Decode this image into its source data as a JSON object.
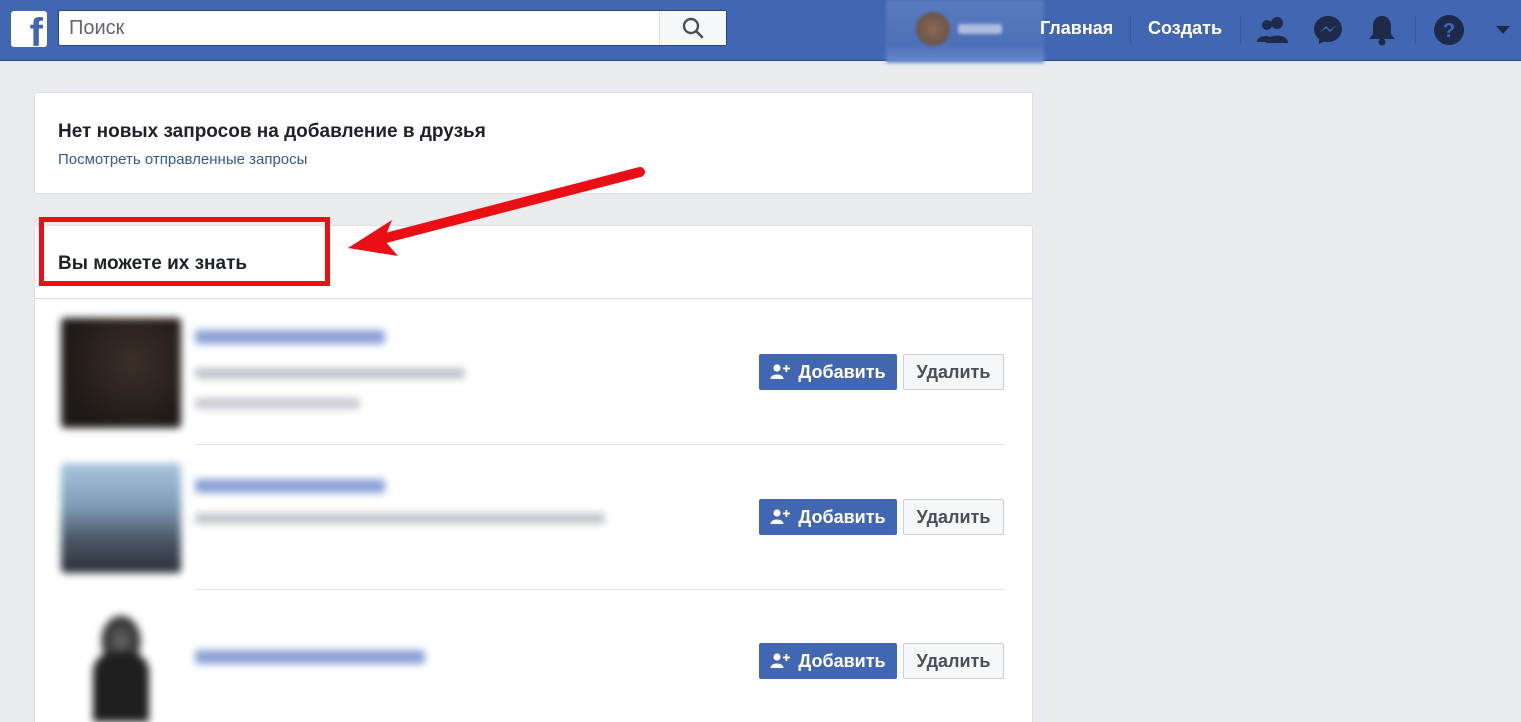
{
  "header": {
    "logo_letter": "f",
    "search_placeholder": "Поиск",
    "nav": {
      "home": "Главная",
      "create": "Создать"
    },
    "icons": [
      "friends-icon",
      "messenger-icon",
      "notifications-icon",
      "help-icon",
      "account-menu-icon"
    ]
  },
  "requests_card": {
    "title": "Нет новых запросов на добавление в друзья",
    "link": "Посмотреть отправленные запросы"
  },
  "suggestions_card": {
    "title": "Вы можете их знать",
    "add_label": "Добавить",
    "delete_label": "Удалить"
  },
  "colors": {
    "brand": "#4267b2",
    "highlight": "#ea0f14"
  }
}
